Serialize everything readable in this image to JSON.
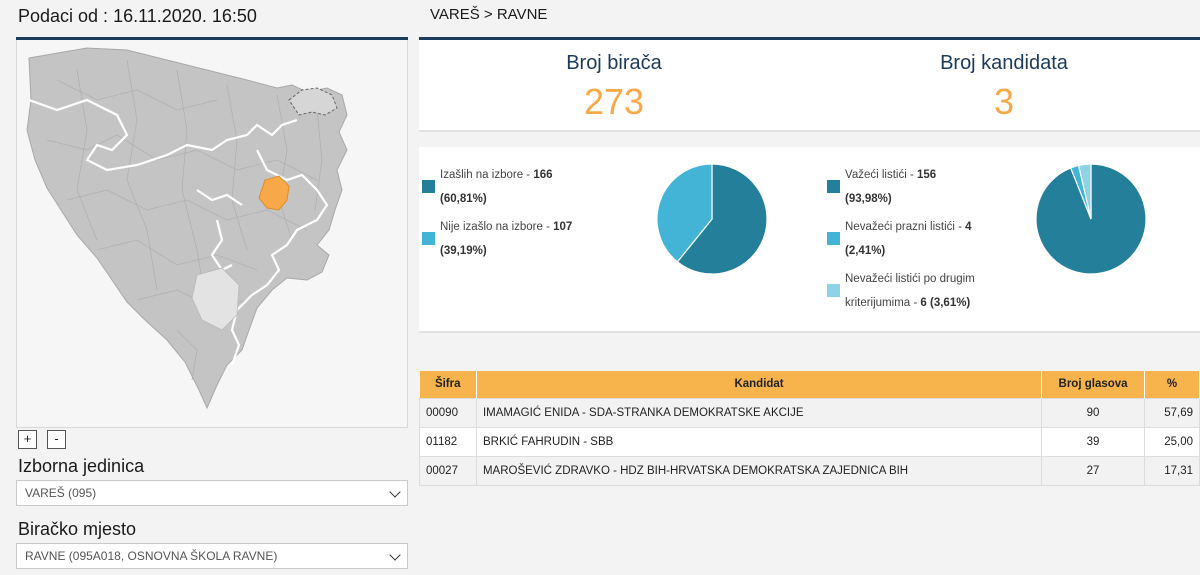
{
  "header": {
    "timestamp": "Podaci od : 16.11.2020. 16:50",
    "breadcrumb": "VAREŠ > RAVNE"
  },
  "map": {
    "zoom_in": "+",
    "zoom_out": "-"
  },
  "selectors": {
    "unit_label": "Izborna jedinica",
    "unit_value": "VAREŠ (095)",
    "station_label": "Biračko mjesto",
    "station_value": "RAVNE (095A018, OSNOVNA ŠKOLA RAVNE)"
  },
  "stats": {
    "voters_label": "Broj birača",
    "voters_value": "273",
    "candidates_label": "Broj kandidata",
    "candidates_value": "3"
  },
  "turnout": {
    "items": [
      {
        "label": "Izašlih na izbore - ",
        "count": "166",
        "pct": "(60,81%)",
        "color": "#237f9a",
        "share": 60.81
      },
      {
        "label": "Nije izašlo na izbore - ",
        "count": "107",
        "pct": "(39,19%)",
        "color": "#43b3d6",
        "share": 39.19
      }
    ]
  },
  "ballots": {
    "items": [
      {
        "label": "Važeći listići - ",
        "count": "156",
        "pct": "(93,98%)",
        "color": "#237f9a",
        "share": 93.98
      },
      {
        "label": "Nevažeći prazni listići - ",
        "count": "4",
        "pct": "(2,41%)",
        "color": "#43b3d6",
        "share": 2.41
      },
      {
        "label_a": "Nevažeći listići po drugim",
        "label_b": "kriterijumima - ",
        "count": "6",
        "pct": "(3,61%)",
        "color": "#8ed2e6",
        "share": 3.61
      }
    ]
  },
  "table": {
    "headers": {
      "code": "Šifra",
      "candidate": "Kandidat",
      "votes": "Broj glasova",
      "pct": "%"
    },
    "rows": [
      {
        "code": "00090",
        "candidate": "IMAMAGIĆ ENIDA - SDA-STRANKA DEMOKRATSKE AKCIJE",
        "votes": "90",
        "pct": "57,69"
      },
      {
        "code": "01182",
        "candidate": "BRKIĆ FAHRUDIN - SBB",
        "votes": "39",
        "pct": "25,00"
      },
      {
        "code": "00027",
        "candidate": "MAROŠEVIĆ ZDRAVKO - HDZ BIH-HRVATSKA DEMOKRATSKA ZAJEDNICA BIH",
        "votes": "27",
        "pct": "17,31"
      }
    ]
  }
}
